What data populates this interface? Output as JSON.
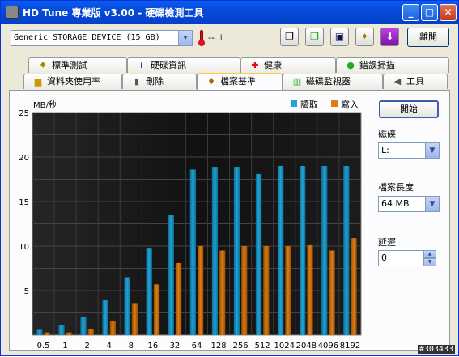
{
  "window": {
    "title": "HD Tune 專業版 v3.00 - 硬碟檢測工具",
    "minimize": "_",
    "maximize": "□",
    "close": "✕"
  },
  "toolbar": {
    "drive": "Generic STORAGE DEVICE (15 GB)",
    "temperature": "-- ⊥",
    "exit_label": "離開",
    "icons": [
      "copy-icon",
      "copy-alt-icon",
      "save-icon",
      "options-icon",
      "download-icon"
    ]
  },
  "tabs_row1": [
    {
      "label": "標準測試",
      "icon": "benchmark-icon"
    },
    {
      "label": "硬碟資訊",
      "icon": "info-icon"
    },
    {
      "label": "健康",
      "icon": "health-icon"
    },
    {
      "label": "錯誤掃描",
      "icon": "scan-icon"
    }
  ],
  "tabs_row2": [
    {
      "label": "資料夾使用率",
      "icon": "folder-icon"
    },
    {
      "label": "刪除",
      "icon": "trash-icon"
    },
    {
      "label": "檔案基準",
      "icon": "file-benchmark-icon",
      "active": true
    },
    {
      "label": "磁碟監視器",
      "icon": "monitor-icon"
    },
    {
      "label": "工具",
      "icon": "speaker-icon"
    }
  ],
  "side": {
    "start_label": "開始",
    "disk_label": "磁碟",
    "disk_value": "L:",
    "file_length_label": "檔案長度",
    "file_length_value": "64 MB",
    "delay_label": "延遲",
    "delay_value": "0"
  },
  "watermark": "#303433",
  "colors": {
    "read": "#1fa4d6",
    "write": "#e07d10",
    "plot_bg": "#0a0a0a"
  },
  "chart_data": {
    "type": "bar",
    "ylabel": "MB/秒",
    "ylim": [
      0,
      25
    ],
    "yticks": [
      5,
      10,
      15,
      20,
      25
    ],
    "categories": [
      "0.5",
      "1",
      "2",
      "4",
      "8",
      "16",
      "32",
      "64",
      "128",
      "256",
      "512",
      "1024",
      "2048",
      "4096",
      "8192"
    ],
    "series": [
      {
        "name": "讀取",
        "values": [
          0.6,
          1.1,
          2.1,
          3.9,
          6.5,
          9.8,
          13.5,
          18.6,
          18.9,
          18.9,
          18.1,
          19.0,
          19.0,
          19.0,
          19.0
        ]
      },
      {
        "name": "寫入",
        "values": [
          0.3,
          0.3,
          0.7,
          1.6,
          3.6,
          5.7,
          8.1,
          10.0,
          9.5,
          10.0,
          10.0,
          10.0,
          10.1,
          9.5,
          10.9
        ]
      }
    ],
    "grid": true,
    "legend": "top-right"
  }
}
